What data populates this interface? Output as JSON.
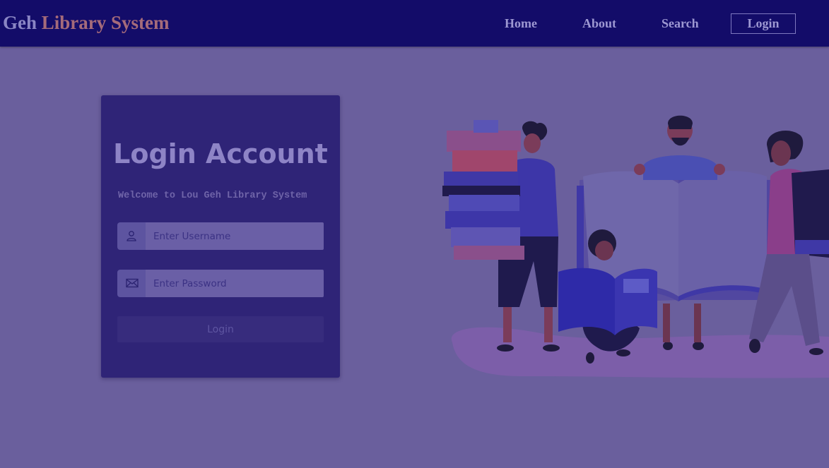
{
  "navbar": {
    "brand_geh": "Geh",
    "brand_rest": " Library System",
    "links": [
      {
        "label": "Home"
      },
      {
        "label": "About"
      },
      {
        "label": "Search"
      },
      {
        "label": "Login"
      }
    ]
  },
  "login_card": {
    "title": "Login Account",
    "subtitle": "Welcome to Lou Geh Library System",
    "username": {
      "placeholder": "Enter Username",
      "icon": "user-icon"
    },
    "password": {
      "placeholder": "Enter Password",
      "icon": "envelope-icon"
    },
    "submit_label": "Login"
  },
  "colors": {
    "page_background": "#6a5f9d",
    "navbar_background": "#130c69",
    "card_background": "#2f2477"
  }
}
